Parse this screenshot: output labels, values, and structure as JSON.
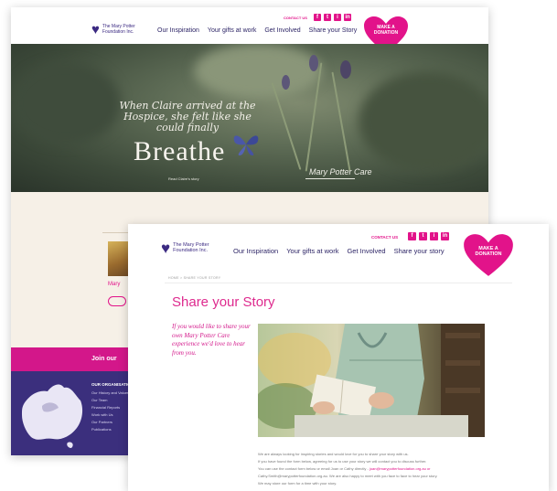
{
  "back_page": {
    "header": {
      "logo_mark": "♥",
      "logo_text_line1": "The Mary Potter",
      "logo_text_line2": "Foundation Inc.",
      "nav": [
        "Our Inspiration",
        "Your gifts at work",
        "Get Involved",
        "Share your Story"
      ],
      "contact_label": "CONTACT US",
      "social_icons": [
        "facebook-icon",
        "twitter-icon",
        "instagram-icon",
        "linkedin-icon"
      ],
      "social_glyphs": [
        "f",
        "t",
        "i",
        "in"
      ],
      "heart_line1": "MAKE A",
      "heart_line2": "DONATION"
    },
    "hero": {
      "quote": "When Claire arrived at the Hospice, she felt like she could finally",
      "headline": "Breathe",
      "signature": "Mary Potter Care",
      "link_text": "Read Claire's story"
    },
    "cream_section": {
      "pink_text": "Mary"
    },
    "pink_band": {
      "text": "Join our"
    },
    "footer": {
      "heading": "OUR ORGANISATION",
      "items": [
        "Our History and Values",
        "Our Team",
        "Financial Reports",
        "Work with Us",
        "Our Partners",
        "Publications"
      ]
    }
  },
  "front_page": {
    "header": {
      "logo_mark": "♥",
      "logo_text_line1": "The Mary Potter",
      "logo_text_line2": "Foundation Inc.",
      "nav": [
        "Our Inspiration",
        "Your gifts at work",
        "Get Involved",
        "Share your story"
      ],
      "contact_label": "CONTACT US",
      "social_icons": [
        "facebook-icon",
        "twitter-icon",
        "instagram-icon",
        "linkedin-icon"
      ],
      "social_glyphs": [
        "f",
        "t",
        "i",
        "in"
      ],
      "heart_line1": "MAKE A",
      "heart_line2": "DONATION"
    },
    "breadcrumb": "HOME  >  SHARE YOUR STORY",
    "title": "Share your Story",
    "intro": "If you would like to share your own Mary Potter Care experience we'd love to hear from you.",
    "body_lines": [
      "We are always looking for inspiring stories and would love for you to share your story with us.",
      "If you have found the form below, agreeing for us to use your story we will contact you to discuss further.",
      "You can use the contact form below or email Joan or Cathy directly -",
      "Cathy.Smith@marypotterfoundation.org.au. We are also happy to meet with you face to face to hear your story.",
      "We may store our form for a time with your story."
    ],
    "body_link": "joan@marypotterfoundation.org.au or"
  },
  "colors": {
    "brand_pink": "#e2138a",
    "brand_purple": "#3b2f7d",
    "cream": "#f6f0e7"
  }
}
